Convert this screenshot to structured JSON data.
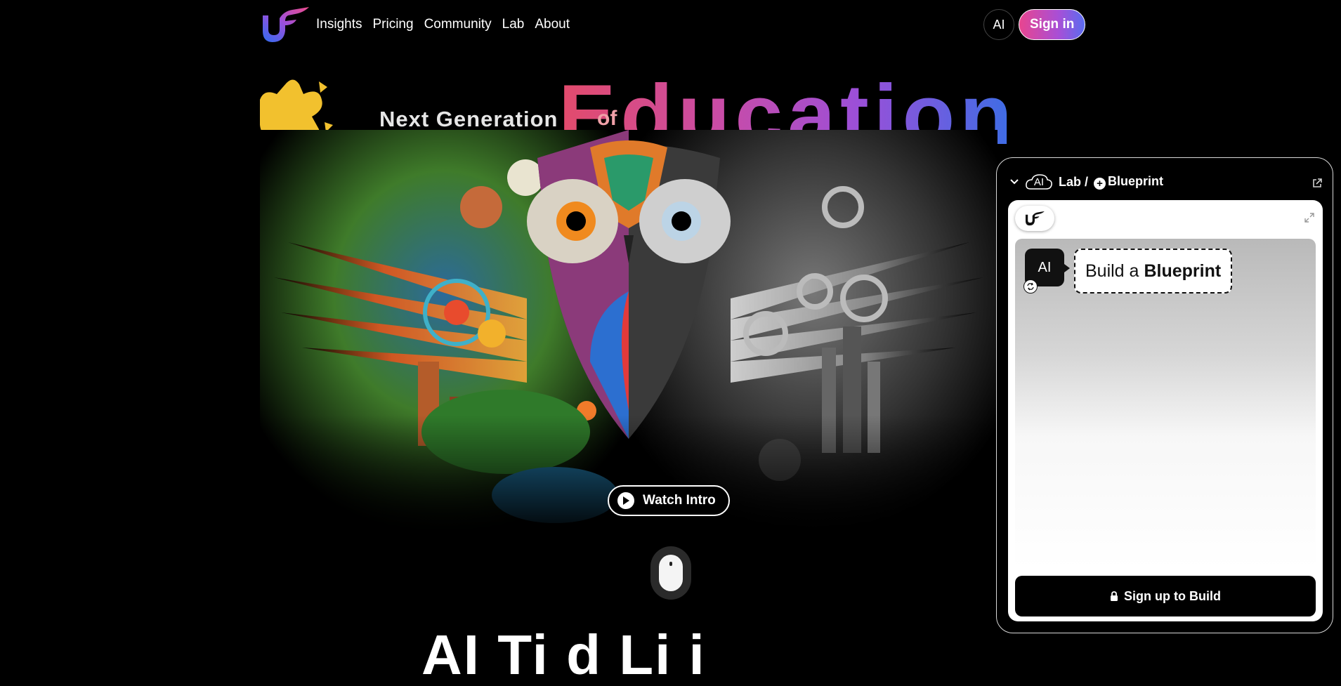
{
  "nav": {
    "links": [
      "Insights",
      "Pricing",
      "Community",
      "Lab",
      "About"
    ],
    "ai_label": "AI",
    "signin_label": "Sign in"
  },
  "hero": {
    "lead": "Next Generation",
    "of": "of",
    "headline": "Education",
    "watch_label": "Watch Intro",
    "below_fold_text": "AI Ti   d  Li  i  "
  },
  "lab_panel": {
    "ai_label": "AI",
    "breadcrumb_lab": "Lab /",
    "breadcrumb_blueprint": "Blueprint",
    "avatar_label": "AI",
    "bubble_prefix": "Build a",
    "bubble_strong": "Blueprint",
    "signup_label": "Sign up to Build"
  },
  "colors": {
    "accent_pink": "#e8458f",
    "accent_purple": "#a84fd6",
    "accent_blue": "#5a6cf0",
    "star_yellow": "#f2c12e"
  },
  "icons": [
    "brand-logo",
    "chevron-down-icon",
    "ai-cloud-icon",
    "plus-circle-icon",
    "external-link-icon",
    "expand-icon",
    "play-icon",
    "mouse-scroll-icon",
    "lock-icon",
    "sync-icon"
  ]
}
